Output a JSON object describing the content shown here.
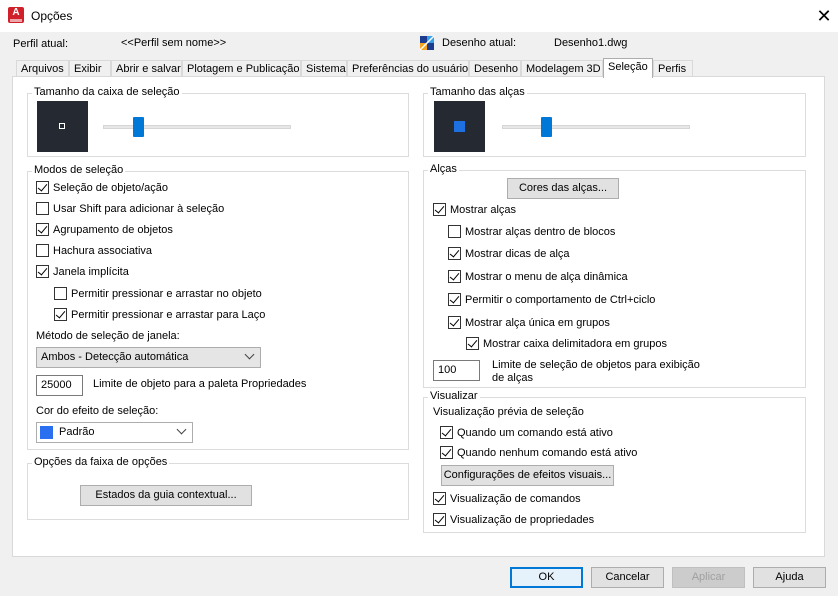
{
  "window": {
    "title": "Opções",
    "close_glyph": "✕"
  },
  "header": {
    "profile_label": "Perfil atual:",
    "profile_value": "<<Perfil sem nome>>",
    "drawing_label": "Desenho atual:",
    "drawing_value": "Desenho1.dwg"
  },
  "tabs": [
    "Arquivos",
    "Exibir",
    "Abrir e salvar",
    "Plotagem e Publicação",
    "Sistema",
    "Preferências do usuário",
    "Desenho",
    "Modelagem 3D",
    "Seleção",
    "Perfis"
  ],
  "active_tab": "Seleção",
  "pickbox": {
    "title": "Tamanho da caixa de seleção",
    "level": 0.17
  },
  "grip_size": {
    "title": "Tamanho das alças",
    "level": 0.22
  },
  "selection_modes": {
    "title": "Modos de seleção",
    "items": [
      {
        "label": "Seleção de objeto/ação",
        "checked": true
      },
      {
        "label": "Usar Shift para adicionar à seleção",
        "checked": false
      },
      {
        "label": "Agrupamento de objetos",
        "checked": true
      },
      {
        "label": "Hachura associativa",
        "checked": false
      },
      {
        "label": "Janela implícita",
        "checked": true
      },
      {
        "label": "Permitir pressionar e arrastar no objeto",
        "checked": false
      },
      {
        "label": "Permitir pressionar e arrastar para Laço",
        "checked": true
      }
    ],
    "window_method_label": "Método de seleção de janela:",
    "window_method_value": "Ambos - Detecção automática",
    "object_limit_value": "25000",
    "object_limit_label": "Limite de objeto para a paleta Propriedades",
    "effect_color_label": "Cor do efeito de seleção:",
    "effect_color_value": "Padrão",
    "effect_color_hex": "#2a6ff0"
  },
  "ribbon": {
    "title": "Opções da faixa de opções",
    "button": "Estados da guia contextual..."
  },
  "grips": {
    "title": "Alças",
    "colors_button": "Cores das alças...",
    "items": [
      {
        "label": "Mostrar alças",
        "checked": true
      },
      {
        "label": "Mostrar alças dentro de blocos",
        "checked": false
      },
      {
        "label": "Mostrar dicas de alça",
        "checked": true
      },
      {
        "label": "Mostrar o menu de alça dinâmica",
        "checked": true
      },
      {
        "label": "Permitir o comportamento de Ctrl+ciclo",
        "checked": true
      },
      {
        "label": "Mostrar alça única em grupos",
        "checked": true
      },
      {
        "label": "Mostrar caixa delimitadora em grupos",
        "checked": true
      }
    ],
    "limit_value": "100",
    "limit_label_line1": "Limite de seleção de objetos para exibição",
    "limit_label_line2": "de alças"
  },
  "preview": {
    "title": "Visualizar",
    "subtitle": "Visualização prévia de seleção",
    "items": [
      {
        "label": "Quando um comando está ativo",
        "checked": true
      },
      {
        "label": "Quando nenhum comando está ativo",
        "checked": true
      }
    ],
    "effects_button": "Configurações de efeitos visuais...",
    "items2": [
      {
        "label": "Visualização de comandos",
        "checked": true
      },
      {
        "label": "Visualização de propriedades",
        "checked": true
      }
    ]
  },
  "footer": {
    "ok": "OK",
    "cancel": "Cancelar",
    "apply": "Aplicar",
    "help": "Ajuda"
  },
  "colors": {
    "accent": "#0078d7",
    "preview_bg": "#252a32",
    "grip_blue": "#1e6fe0"
  }
}
